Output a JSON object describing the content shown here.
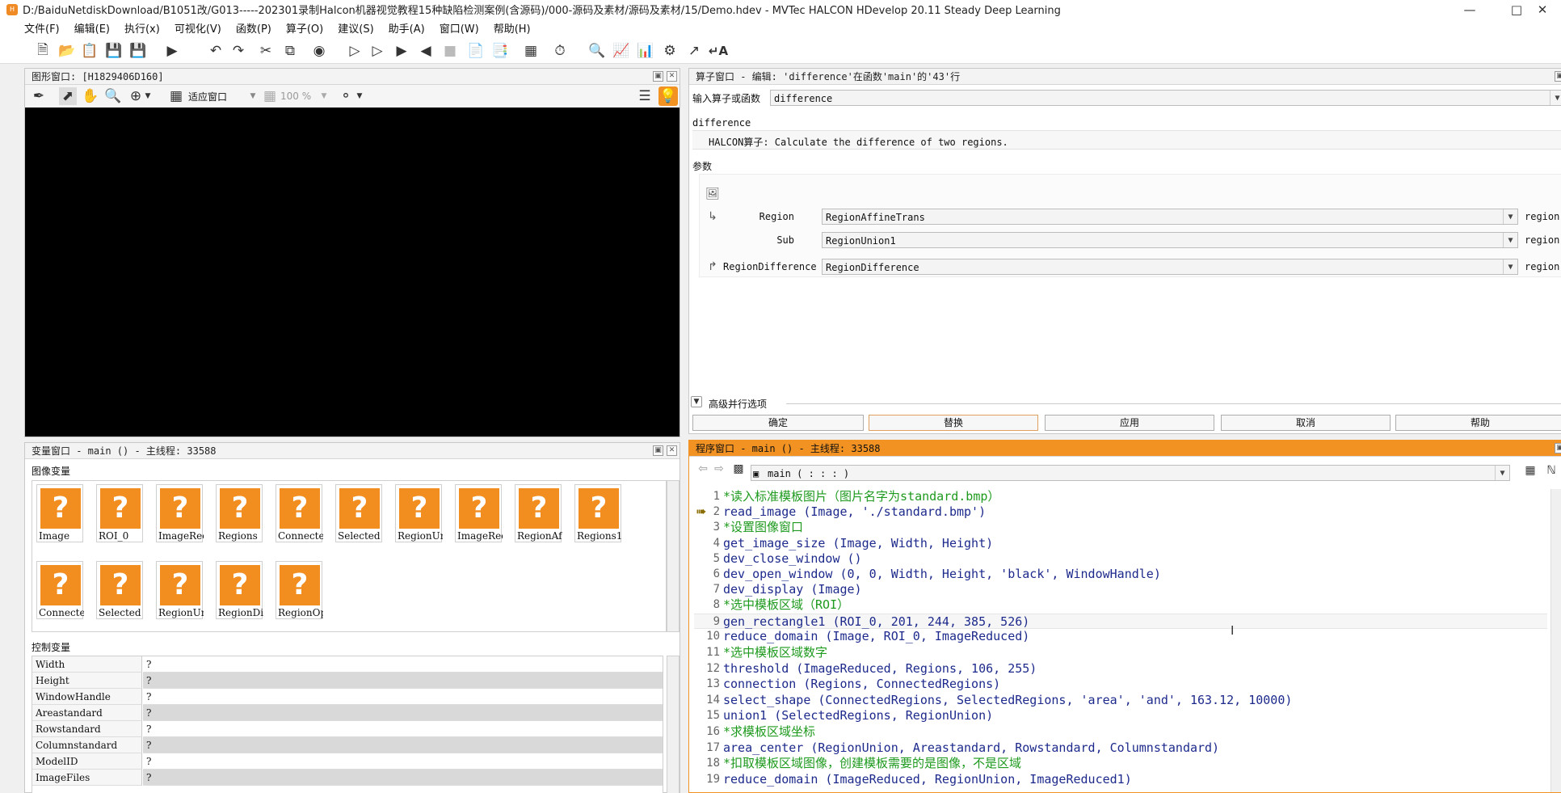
{
  "title": "D:/BaiduNetdiskDownload/B1051改/G013-----202301录制Halcon机器视觉教程15种缺陷检测案例(含源码)/000-源码及素材/源码及素材/15/Demo.hdev - MVTec HALCON HDevelop 20.11 Steady Deep Learning",
  "menu": [
    "文件(F)",
    "编辑(E)",
    "执行(x)",
    "可视化(V)",
    "函数(P)",
    "算子(O)",
    "建议(S)",
    "助手(A)",
    "窗口(W)",
    "帮助(H)"
  ],
  "graphics": {
    "header": "图形窗口: [H1829406D160]",
    "fit": "适应窗口",
    "zoom": "100 %"
  },
  "operator": {
    "header": "算子窗口 - 编辑: 'difference'在函数'main'的'43'行",
    "input_label": "输入算子或函数",
    "input_value": "difference",
    "name": "difference",
    "desc": "HALCON算子: Calculate the difference of two regions.",
    "params_title": "参数",
    "params": [
      {
        "label": "Region",
        "value": "RegionAffineTrans",
        "type": "region"
      },
      {
        "label": "Sub",
        "value": "RegionUnion1",
        "type": "region"
      },
      {
        "label": "RegionDifference",
        "value": "RegionDifference",
        "type": "region"
      }
    ],
    "advanced": "高级并行选项",
    "buttons": [
      "确定",
      "替换",
      "应用",
      "取消",
      "帮助"
    ]
  },
  "variables": {
    "header": "变量窗口 - main () - 主线程: 33588",
    "image_section": "图像变量",
    "icon_glyph": "?",
    "images": [
      "Image",
      "ROI_0",
      "ImageRed",
      "Regions",
      "Connecte",
      "Selected",
      "RegionUn",
      "ImageRed",
      "RegionAf",
      "Regions1",
      "Connecte",
      "Selected",
      "RegionUn",
      "RegionDi",
      "RegionOp"
    ],
    "control_section": "控制变量",
    "controls": [
      {
        "name": "Width",
        "value": "?"
      },
      {
        "name": "Height",
        "value": "?"
      },
      {
        "name": "WindowHandle",
        "value": "?"
      },
      {
        "name": "Areastandard",
        "value": "?"
      },
      {
        "name": "Rowstandard",
        "value": "?"
      },
      {
        "name": "Columnstandard",
        "value": "?"
      },
      {
        "name": "ModelID",
        "value": "?"
      },
      {
        "name": "ImageFiles",
        "value": "?"
      }
    ]
  },
  "program": {
    "header": "程序窗口 - main () - 主线程: 33588",
    "proc": "main ( : : : )",
    "lines": [
      {
        "n": "1",
        "t": "*读入标准模板图片（图片名字为standard.bmp）",
        "c": "cmt"
      },
      {
        "n": "2",
        "t": "read_image (Image, './standard.bmp')",
        "c": "op"
      },
      {
        "n": "3",
        "t": "*设置图像窗口",
        "c": "cmt"
      },
      {
        "n": "4",
        "t": "get_image_size (Image, Width, Height)",
        "c": "op"
      },
      {
        "n": "5",
        "t": "dev_close_window ()",
        "c": "op"
      },
      {
        "n": "6",
        "t": "dev_open_window (0, 0, Width, Height, 'black', WindowHandle)",
        "c": "op"
      },
      {
        "n": "7",
        "t": "dev_display (Image)",
        "c": "op"
      },
      {
        "n": "8",
        "t": "*选中模板区域（ROI）",
        "c": "cmt"
      },
      {
        "n": "9",
        "t": "gen_rectangle1 (ROI_0, 201, 244, 385, 526)",
        "c": "op"
      },
      {
        "n": "10",
        "t": "reduce_domain (Image, ROI_0, ImageReduced)",
        "c": "op"
      },
      {
        "n": "11",
        "t": "*选中模板区域数字",
        "c": "cmt"
      },
      {
        "n": "12",
        "t": "threshold (ImageReduced, Regions, 106, 255)",
        "c": "op"
      },
      {
        "n": "13",
        "t": "connection (Regions, ConnectedRegions)",
        "c": "op"
      },
      {
        "n": "14",
        "t": "select_shape (ConnectedRegions, SelectedRegions, 'area', 'and', 163.12, 10000)",
        "c": "op"
      },
      {
        "n": "15",
        "t": "union1 (SelectedRegions, RegionUnion)",
        "c": "op"
      },
      {
        "n": "16",
        "t": "*求模板区域坐标",
        "c": "cmt"
      },
      {
        "n": "17",
        "t": "area_center (RegionUnion, Areastandard, Rowstandard, Columnstandard)",
        "c": "op"
      },
      {
        "n": "18",
        "t": "*扣取模板区域图像，创建模板需要的是图像，不是区域",
        "c": "cmt"
      },
      {
        "n": "19",
        "t": "reduce_domain (ImageReduced, RegionUnion, ImageReduced1)",
        "c": "op"
      }
    ]
  },
  "colors": {
    "accent": "#f29222",
    "comment": "#1e9a1e",
    "code": "#1d2a8c",
    "thumb": "#f28d1f"
  }
}
